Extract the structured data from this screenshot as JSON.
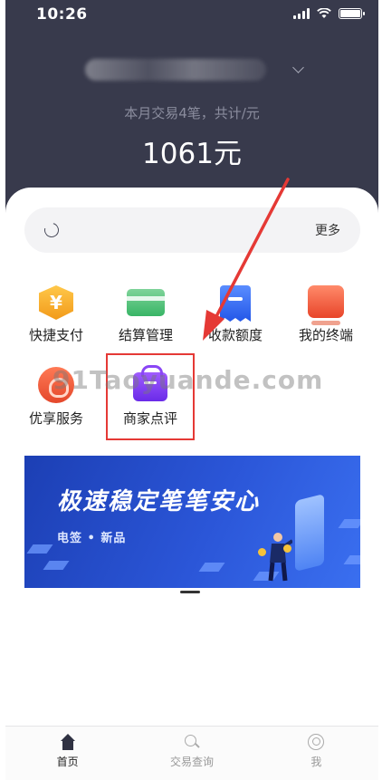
{
  "status_bar": {
    "time": "10:26"
  },
  "header": {
    "month_summary": "本月交易4笔，共计/元",
    "month_amount": "1061元"
  },
  "notice": {
    "more_label": "更多"
  },
  "grid": {
    "items": [
      {
        "label": "快捷支付",
        "icon": "yuan-shield-icon"
      },
      {
        "label": "结算管理",
        "icon": "card-icon"
      },
      {
        "label": "收款额度",
        "icon": "receipt-icon"
      },
      {
        "label": "我的终端",
        "icon": "terminal-icon"
      },
      {
        "label": "优享服务",
        "icon": "gift-icon"
      },
      {
        "label": "商家点评",
        "icon": "shopping-bag-icon"
      }
    ]
  },
  "watermark": {
    "text": "91Taoyuande.com"
  },
  "banner": {
    "title": "极速稳定笔笔安心",
    "subtitle": "电签 • 新品"
  },
  "tab_bar": {
    "tabs": [
      {
        "label": "首页",
        "active": true
      },
      {
        "label": "交易查询",
        "active": false
      },
      {
        "label": "我",
        "active": false
      }
    ]
  },
  "colors": {
    "header_bg": "#383a4c",
    "highlight": "#e53935",
    "banner_blue": "#2b56d8"
  }
}
